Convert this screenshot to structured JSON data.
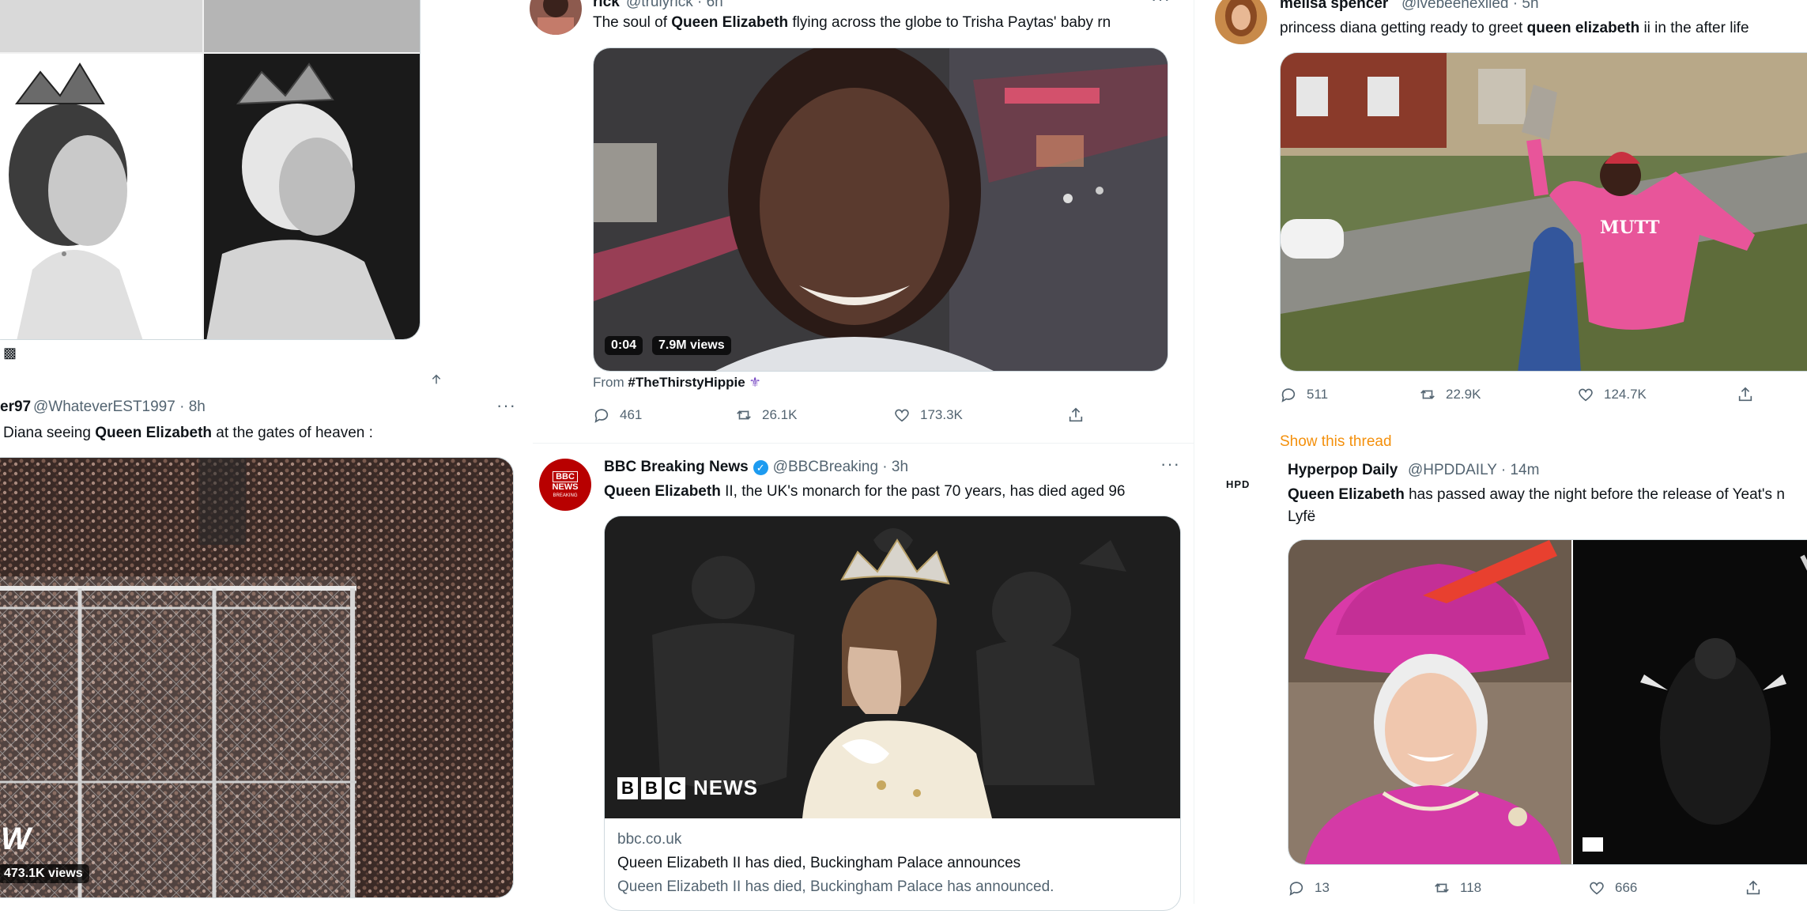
{
  "col1": {
    "top_icon": "gamepad-icon",
    "tweet": {
      "name": "er97",
      "handle": "@WhateverEST1997 · 8h",
      "text_pre": "Diana seeing ",
      "text_bold": "Queen Elizabeth",
      "text_post": " at the gates of heaven :",
      "views": "473.1K views",
      "logo": "W"
    },
    "share_icon": "share-icon"
  },
  "col2": {
    "tweet_top": {
      "name": "rick",
      "handle": "@trulyrick · 6h",
      "text_pre": "The soul of ",
      "text_bold": "Queen Elizabeth",
      "text_post": " flying across the globe to Trisha Paytas' baby rn",
      "duration": "0:04",
      "views": "7.9M views",
      "from_label": "From ",
      "from_tag": "#TheThirstyHippie",
      "replies": "461",
      "retweets": "26.1K",
      "likes": "173.3K"
    },
    "tweet_bbc": {
      "avatar_line1": "BBC",
      "avatar_line2": "NEWS",
      "avatar_line3": "BREAKING",
      "name": "BBC Breaking News",
      "handle": "@BBCBreaking · 3h",
      "text_bold": "Queen Elizabeth",
      "text_post": " II, the UK's monarch for the past 70 years, has died aged 96",
      "card_logo_letters": [
        "B",
        "B",
        "C"
      ],
      "card_logo_word": "NEWS",
      "card_domain": "bbc.co.uk",
      "card_title": "Queen Elizabeth II has died, Buckingham Palace announces",
      "card_desc": "Queen Elizabeth II has died, Buckingham Palace has announced."
    }
  },
  "col3": {
    "tweet_top": {
      "name": "melisa spencer",
      "handle": "@ivebeenexiled · 5h",
      "text_pre": "princess diana getting ready to greet ",
      "text_bold": "queen elizabeth",
      "text_post": " ii in the after life",
      "replies": "511",
      "retweets": "22.9K",
      "likes": "124.7K",
      "sweatshirt_text": "MUTT"
    },
    "show_thread": "Show this thread",
    "tweet_hpd": {
      "avatar_text": "HPD",
      "name": "Hyperpop Daily",
      "handle": "@HPDDAILY · 14m",
      "text_bold": "Queen Elizabeth",
      "text_post": " has passed away the night before the release of Yeat's n",
      "text_line2": "Lyfë",
      "replies": "13",
      "retweets": "118",
      "likes": "666"
    }
  },
  "colors": {
    "accent_orange": "#f4900c",
    "bbc_red": "#b80000",
    "verified_blue": "#1d9bf0",
    "muted": "#536471"
  }
}
